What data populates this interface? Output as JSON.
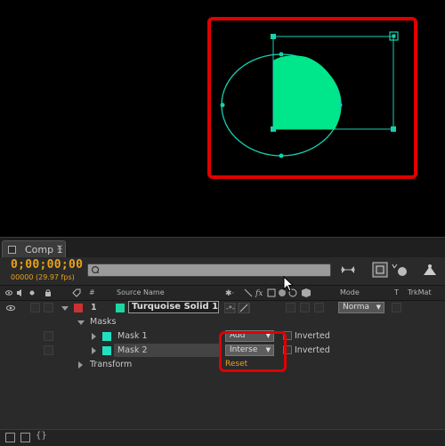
{
  "composition": {
    "tab_label": "Comp 1",
    "tab_close": "×",
    "timecode": "0;00;00;00",
    "frame_info": "00000 (29.97 fps)",
    "search_placeholder": ""
  },
  "columns": {
    "number": "#",
    "source_name": "Source Name",
    "mode": "Mode",
    "t": "T",
    "trkmat": "TrkMat"
  },
  "layer": {
    "index": "1",
    "name": "Turquoise Solid 1",
    "color": "#1fd6a0",
    "label_color": "#c83232",
    "mode": "Norma"
  },
  "masks_group": {
    "label": "Masks",
    "items": [
      {
        "name": "Mask 1",
        "mode": "Add",
        "inverted_label": "Inverted",
        "color": "#1fe0c0"
      },
      {
        "name": "Mask 2",
        "mode": "Interse",
        "inverted_label": "Inverted",
        "color": "#1fe0c0"
      }
    ],
    "reset_label": "Reset"
  },
  "transform": {
    "label": "Transform"
  },
  "colors": {
    "accent_orange": "#e8a21a",
    "highlight_red": "#e00000",
    "shape_fill": "#00e68a",
    "mask_path": "#18d0b0"
  }
}
